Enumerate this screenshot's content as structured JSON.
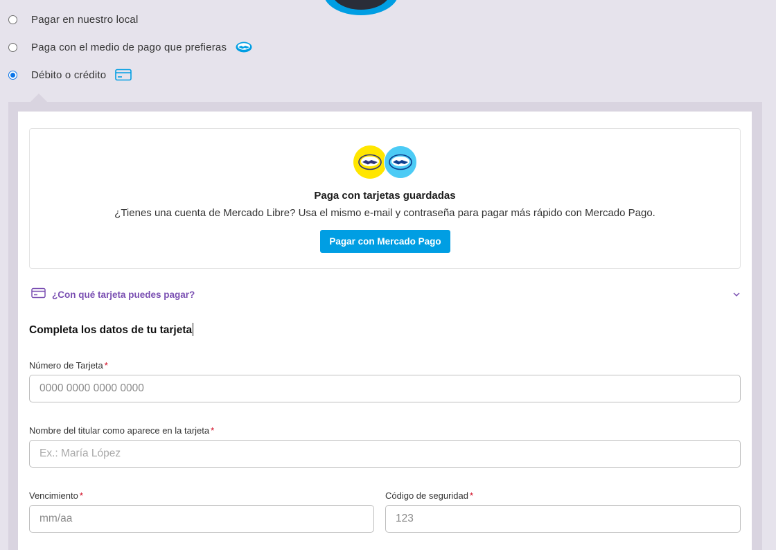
{
  "payment_options": [
    {
      "label": "Pagar en nuestro local",
      "checked": false,
      "icon": ""
    },
    {
      "label": "Paga con el medio de pago que prefieras",
      "checked": false,
      "icon": "mercadopago-handshake-icon"
    },
    {
      "label": "Débito o crédito",
      "checked": true,
      "icon": "credit-card-icon"
    }
  ],
  "saved_cards": {
    "title": "Paga con tarjetas guardadas",
    "description": "¿Tienes una cuenta de Mercado Libre? Usa el mismo e-mail y contraseña para pagar más rápido con Mercado Pago.",
    "button_label": "Pagar con Mercado Pago"
  },
  "which_cards": {
    "label": "¿Con qué tarjeta puedes pagar?"
  },
  "form": {
    "title": "Completa los datos de tu tarjeta",
    "card_number": {
      "label": "Número de Tarjeta",
      "required_mark": "*",
      "placeholder": "0000 0000 0000 0000",
      "value": ""
    },
    "holder_name": {
      "label": "Nombre del titular como aparece en la tarjeta",
      "required_mark": "*",
      "placeholder": "Ex.: María López",
      "value": ""
    },
    "expiry": {
      "label": "Vencimiento",
      "required_mark": "*",
      "placeholder": "mm/aa",
      "value": ""
    },
    "security_code": {
      "label": "Código de seguridad",
      "required_mark": "*",
      "placeholder": "123",
      "value": ""
    }
  },
  "colors": {
    "page_background": "#e6e3ec",
    "mercado_pago_blue": "#009ee3",
    "mercado_libre_yellow": "#ffe600",
    "link_purple": "#7a4fb2",
    "radio_blue": "#0a74e8",
    "required_red": "#d0021b"
  }
}
